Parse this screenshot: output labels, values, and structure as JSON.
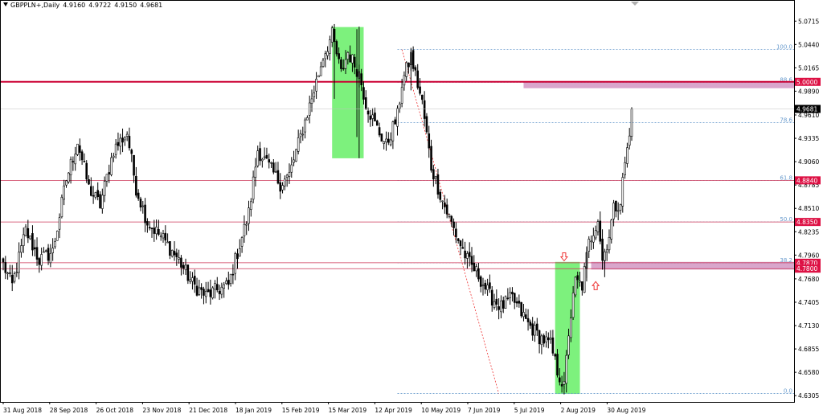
{
  "header": {
    "symbol": "GBPPLN+,Daily",
    "values": [
      "4.9160",
      "4.9722",
      "4.9150",
      "4.9681"
    ]
  },
  "colors": {
    "candle": "#000000",
    "horizontal_line": "#cc3355",
    "main_line": "#cc0033",
    "zone": "#cc88bb",
    "highlight": "#66ee66",
    "fib": "#6699cc",
    "trend": "#ee3333",
    "price_box": "#dd1144",
    "current_box": "#000000"
  },
  "chart_data": {
    "type": "candlestick",
    "symbol": "GBPPLN+",
    "timeframe": "Daily",
    "ylim": [
      4.625,
      5.085
    ],
    "y_ticks": [
      "5.0715",
      "5.0440",
      "5.0165",
      "4.9890",
      "4.9610",
      "4.9335",
      "4.9060",
      "4.8785",
      "4.8510",
      "4.8235",
      "4.7960",
      "4.7680",
      "4.7405",
      "4.7130",
      "4.6855",
      "4.6580",
      "4.6305"
    ],
    "x_ticks": [
      "31 Aug 2018",
      "28 Sep 2018",
      "26 Oct 2018",
      "23 Nov 2018",
      "21 Dec 2018",
      "18 Jan 2019",
      "15 Feb 2019",
      "15 Mar 2019",
      "12 Apr 2019",
      "10 May 2019",
      "7 Jun 2019",
      "5 Jul 2019",
      "2 Aug 2019",
      "30 Aug 2019"
    ],
    "n_bars": 280,
    "anchors": [
      [
        0,
        4.785
      ],
      [
        5,
        4.76
      ],
      [
        12,
        4.825
      ],
      [
        18,
        4.79
      ],
      [
        25,
        4.8
      ],
      [
        32,
        4.885
      ],
      [
        38,
        4.93
      ],
      [
        44,
        4.875
      ],
      [
        50,
        4.855
      ],
      [
        57,
        4.92
      ],
      [
        64,
        4.94
      ],
      [
        68,
        4.875
      ],
      [
        74,
        4.835
      ],
      [
        82,
        4.815
      ],
      [
        90,
        4.79
      ],
      [
        97,
        4.762
      ],
      [
        104,
        4.748
      ],
      [
        110,
        4.755
      ],
      [
        116,
        4.76
      ],
      [
        120,
        4.79
      ],
      [
        126,
        4.845
      ],
      [
        131,
        4.92
      ],
      [
        137,
        4.9
      ],
      [
        143,
        4.88
      ],
      [
        148,
        4.89
      ],
      [
        154,
        4.945
      ],
      [
        160,
        4.99
      ],
      [
        165,
        5.03
      ],
      [
        170,
        5.055
      ],
      [
        174,
        5.01
      ],
      [
        178,
        5.035
      ],
      [
        183,
        5.01
      ],
      [
        187,
        4.975
      ],
      [
        192,
        4.95
      ],
      [
        197,
        4.925
      ],
      [
        203,
        4.96
      ],
      [
        206,
        4.998
      ],
      [
        210,
        5.03
      ],
      [
        216,
        4.975
      ],
      [
        221,
        4.9
      ],
      [
        227,
        4.86
      ],
      [
        233,
        4.82
      ],
      [
        239,
        4.79
      ],
      [
        245,
        4.772
      ],
      [
        251,
        4.748
      ],
      [
        257,
        4.735
      ],
      [
        263,
        4.745
      ],
      [
        270,
        4.715
      ],
      [
        276,
        4.7
      ],
      [
        282,
        4.69
      ],
      [
        286,
        4.66
      ],
      [
        289,
        4.64
      ],
      [
        292,
        4.705
      ],
      [
        295,
        4.765
      ],
      [
        298,
        4.76
      ],
      [
        302,
        4.81
      ],
      [
        306,
        4.84
      ],
      [
        309,
        4.79
      ],
      [
        312,
        4.82
      ],
      [
        315,
        4.85
      ],
      [
        318,
        4.86
      ],
      [
        321,
        4.905
      ],
      [
        323,
        4.935
      ],
      [
        324,
        4.968
      ]
    ],
    "spikes": [
      [
        183,
        5.065,
        4.91
      ],
      [
        182,
        5.062,
        4.935
      ],
      [
        171,
        5.068,
        4.98
      ],
      [
        210,
        5.04,
        4.99
      ],
      [
        289,
        4.642,
        4.632
      ],
      [
        301,
        4.805,
        4.765
      ],
      [
        310,
        4.79,
        4.77
      ]
    ],
    "current_price": "4.9681",
    "horizontal_levels": [
      {
        "price": 5.0,
        "label": "5.0000",
        "style": "main"
      },
      {
        "price": 4.884,
        "label": "4.8840",
        "style": "thin"
      },
      {
        "price": 4.835,
        "label": "4.8350",
        "style": "thin"
      },
      {
        "price": 4.787,
        "label": "4.7870",
        "style": "thin"
      },
      {
        "price": 4.78,
        "label": "4.7800",
        "style": "thin"
      }
    ],
    "fibonacci": {
      "x_start_date": "19 Apr 2019",
      "levels": [
        {
          "label": "100.0",
          "price": 5.038
        },
        {
          "label": "88.6",
          "price": 4.9995
        },
        {
          "label": "78.6",
          "price": 4.952
        },
        {
          "label": "61.8",
          "price": 4.884
        },
        {
          "label": "50.0",
          "price": 4.835
        },
        {
          "label": "38.2",
          "price": 4.787
        },
        {
          "label": "0.0",
          "price": 4.633
        }
      ]
    },
    "zones": [
      {
        "from_bar": 268,
        "to_bar": 325,
        "top": 5.0005,
        "bottom": 4.9925
      },
      {
        "from_bar": 303,
        "to_bar": 325,
        "top": 4.788,
        "bottom": 4.779
      }
    ],
    "highlights": [
      {
        "from_bar": 170,
        "to_bar": 186,
        "top": 5.0645,
        "bottom": 4.91
      },
      {
        "from_bar": 284,
        "to_bar": 297,
        "top": 4.788,
        "bottom": 4.6325
      }
    ],
    "trend_lines": [
      {
        "from": [
          205,
          5.038
        ],
        "to": [
          255,
          4.633
        ]
      }
    ],
    "arrows": [
      {
        "bar": 289,
        "price": 4.793,
        "direction": "down"
      },
      {
        "bar": 305,
        "price": 4.761,
        "direction": "up"
      }
    ]
  }
}
